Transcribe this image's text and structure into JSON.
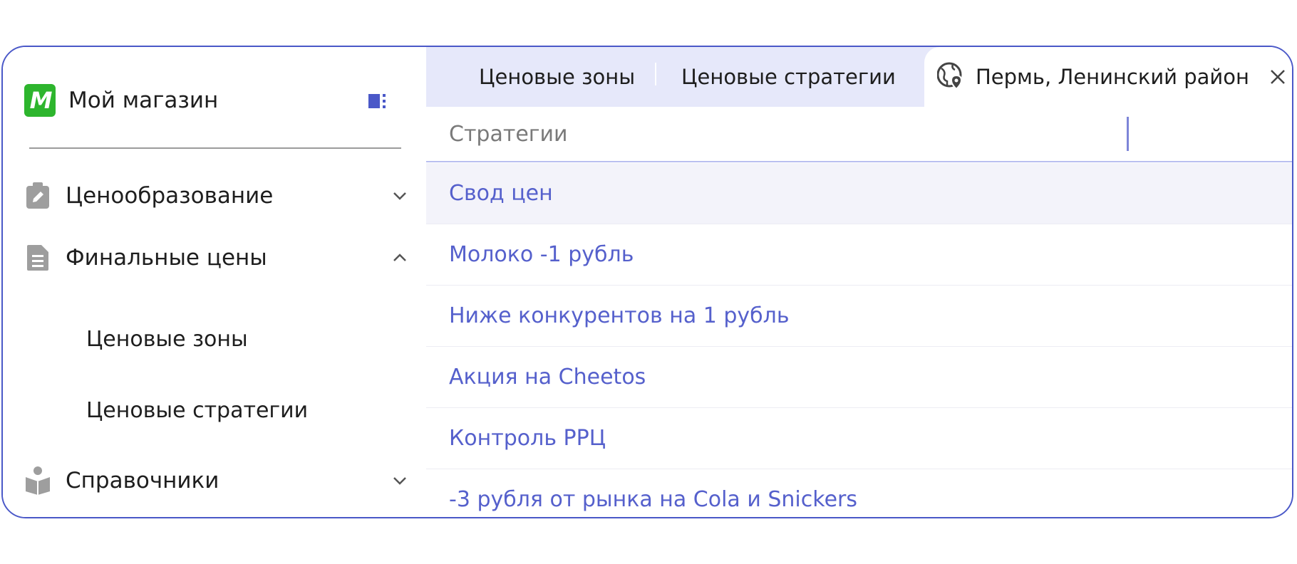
{
  "sidebar": {
    "brand": {
      "logo_text": "M",
      "name": "Мой магазин"
    },
    "collapse_icon": "sidebar-collapse-icon",
    "nav": [
      {
        "label": "Ценообразование",
        "icon": "clipboard-edit-icon",
        "expanded": false
      },
      {
        "label": "Финальные цены",
        "icon": "document-icon",
        "expanded": true
      },
      {
        "label": "Справочники",
        "icon": "book-reader-icon",
        "expanded": false
      }
    ],
    "subitems": [
      "Ценовые зоны",
      "Ценовые стратегии"
    ]
  },
  "tabs": [
    {
      "label": "Ценовые зоны",
      "active": false
    },
    {
      "label": "Ценовые стратегии",
      "active": false
    },
    {
      "label": "Пермь, Ленинский район",
      "active": true,
      "icon": "globe-pin-icon"
    }
  ],
  "search": {
    "placeholder": "Стратегии",
    "value": ""
  },
  "strategies": [
    "Свод цен",
    "Молоко -1 рубль",
    "Ниже конкурентов на 1 рубль",
    "Акция на Cheetos",
    "Контроль РРЦ",
    "-3 рубля от рынка на Cola и Snickers"
  ],
  "colors": {
    "accent": "#5560cc",
    "border": "#4a58c8",
    "tabbar_bg": "#e6e8fa",
    "logo_green": "#2db52d"
  }
}
